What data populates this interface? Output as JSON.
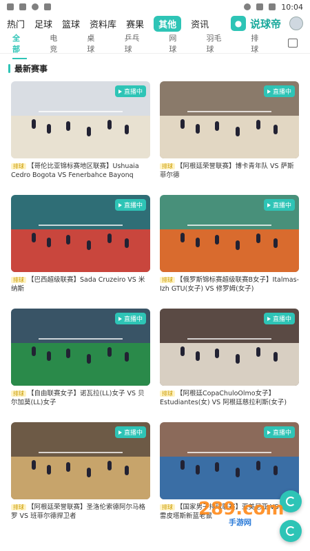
{
  "status": {
    "time": "10:04"
  },
  "nav": {
    "tabs": [
      "热门",
      "足球",
      "篮球",
      "资料库",
      "赛果",
      "其他",
      "资讯"
    ],
    "active_index": 5,
    "brand": "说球帝"
  },
  "subtabs": {
    "items": [
      "全部",
      "电竞",
      "桌球",
      "乒乓球",
      "网球",
      "羽毛球",
      "排球"
    ],
    "active_index": 0
  },
  "section": {
    "title": "最新赛事"
  },
  "live_label": "直播中",
  "cards": [
    {
      "tag": "排球",
      "title": "【哥伦比亚锦标赛地区联赛】Ushuaia Cedro Bogota VS Fenerbahce Bayonq Bogota",
      "color": "#d9dde3",
      "court": "#e8e1d1"
    },
    {
      "tag": "排球",
      "title": "【阿根廷荣誉联赛】博卡青年队 VS 萨斯菲尔德",
      "color": "#8a7a6a",
      "court": "#e2d7c3"
    },
    {
      "tag": "排球",
      "title": "【巴西超级联赛】Sada Cruzeiro VS 米纳斯",
      "color": "#2f6e76",
      "court": "#c9463d"
    },
    {
      "tag": "排球",
      "title": "【俄罗斯锦标赛超级联赛B女子】Italmas-Izh GTU(女子) VS 修罗姆(女子)",
      "color": "#48907a",
      "court": "#d96b2e"
    },
    {
      "tag": "排球",
      "title": "【自由联赛女子】诺瓦拉(LL)女子 VS 贝尔加莫(LL)女子",
      "color": "#395466",
      "court": "#2a8a4a"
    },
    {
      "tag": "排球",
      "title": "【阿根廷CopaChuloOlmo女子】Estudiantes(女) VS 阿根廷慈拉利斯(女子)",
      "color": "#5a4a44",
      "court": "#d8cfc2"
    },
    {
      "tag": "排球",
      "title": "【阿根廷荣誉联赛】圣洛伦索德阿尔马格罗 VS 班菲尔德捍卫者",
      "color": "#6d5a46",
      "court": "#c7a46b"
    },
    {
      "tag": "排球",
      "title": "【国家男子排球联赛】亚美尼亚 VS 埃斯雷皮塔斯新蓝老鼠",
      "color": "#8b6a5a",
      "court": "#3a6ea5"
    }
  ],
  "watermark": {
    "main": "289.com",
    "sub": "手游网"
  }
}
